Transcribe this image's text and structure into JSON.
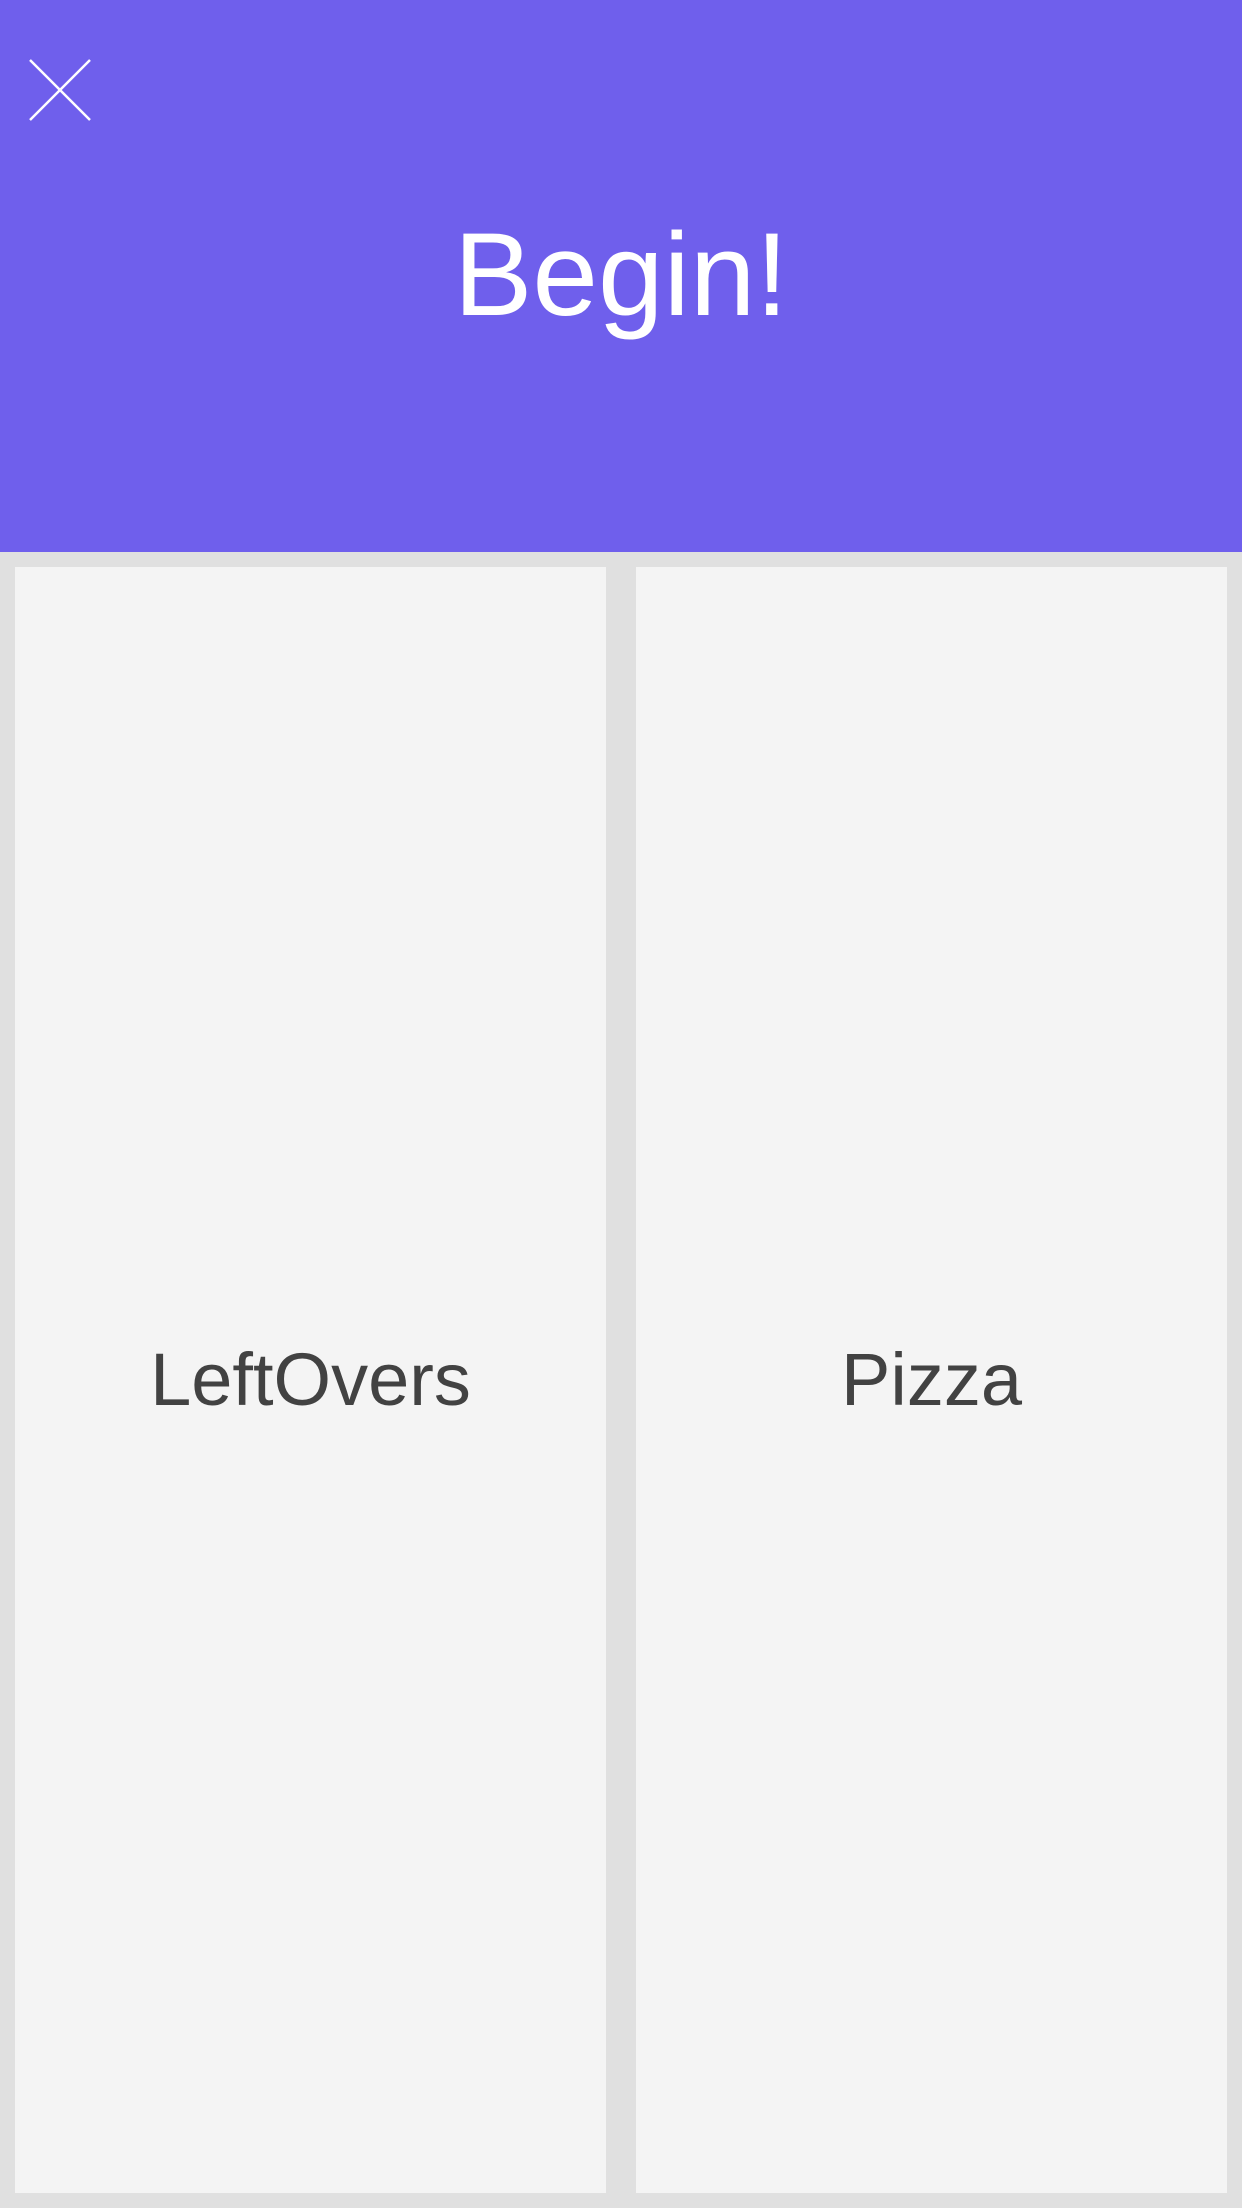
{
  "header": {
    "title": "Begin!",
    "close_icon": "close-icon",
    "background_color": "#6f5fec"
  },
  "options": [
    {
      "label": "LeftOvers"
    },
    {
      "label": "Pizza"
    }
  ],
  "colors": {
    "page_background": "#e0e0e0",
    "tile_background": "#f4f4f4",
    "tile_text": "#424242",
    "header_text": "#ffffff"
  }
}
